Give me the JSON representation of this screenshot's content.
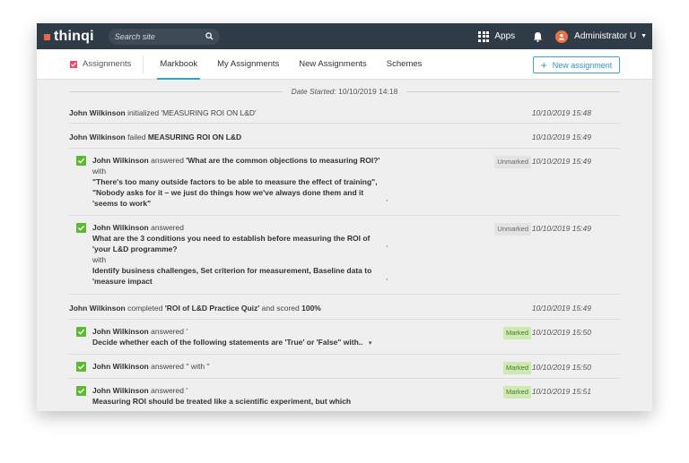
{
  "topbar": {
    "logo": "thinqi",
    "search_placeholder": "Search site",
    "apps_label": "Apps",
    "user_name": "Administrator U"
  },
  "tabbar": {
    "crumb": "Assignments",
    "tabs": [
      "Markbook",
      "My Assignments",
      "New Assignments",
      "Schemes"
    ],
    "new_button": "New assignment"
  },
  "date_started": {
    "label": "Date Started:",
    "value": "10/10/2019 14:18"
  },
  "rows": {
    "r1": {
      "name": "John Wilkinson",
      "action": "initialized",
      "object": "'MEASURING ROI ON L&D'",
      "time": "10/10/2019 15:48"
    },
    "r2": {
      "name": "John Wilkinson",
      "action": "failed",
      "object": "MEASURING ROI ON L&D",
      "time": "10/10/2019 15:49"
    },
    "r3": {
      "name": "John Wilkinson",
      "action": "answered",
      "question": "'What are the common objections to measuring ROI?'",
      "with": "with",
      "a1": "\"There's too many outside factors to be able to measure the effect of training\",",
      "a2": " \"Nobody asks for it – we just do things how we've always done them and it",
      "a3": "'seems to work\"",
      "comma": "'",
      "badge": "Unmarked",
      "time": "10/10/2019 15:49"
    },
    "r4": {
      "name": "John Wilkinson",
      "action": "answered",
      "q1": " What are the 3 conditions you need to establish before measuring the ROI of",
      "q2": "'your L&D programme?",
      "comma1": "'",
      "with": "with",
      "a1": "Identify business challenges, Set criterion for measurement, Baseline data to",
      "a2": "'measure impact",
      "comma2": "'",
      "badge": "Unmarked",
      "time": "10/10/2019 15:49"
    },
    "r5": {
      "name": "John Wilkinson",
      "action": "completed",
      "object": "'ROI of L&D Practice Quiz'",
      "and": "and scored",
      "score": "100%",
      "time": "10/10/2019 15:49"
    },
    "r6": {
      "name": "John Wilkinson",
      "action": "answered '",
      "q": "Decide whether each of the following statements are 'True' or 'False\" with..",
      "caret": "▾",
      "badge": "Marked",
      "time": "10/10/2019 15:50"
    },
    "r7": {
      "name": "John Wilkinson",
      "action": "answered '' with ''",
      "badge": "Marked",
      "time": "10/10/2019 15:50"
    },
    "r8": {
      "name": "John Wilkinson",
      "action": "answered '",
      "q": "Measuring ROI should be treated like a scientific experiment, but which",
      "badge": "Marked",
      "time": "10/10/2019 15:51"
    }
  },
  "colors": {
    "topbar": "#2f3b46",
    "accent": "#28a8c8",
    "check": "#5cb932",
    "logo": "#e8684a"
  }
}
